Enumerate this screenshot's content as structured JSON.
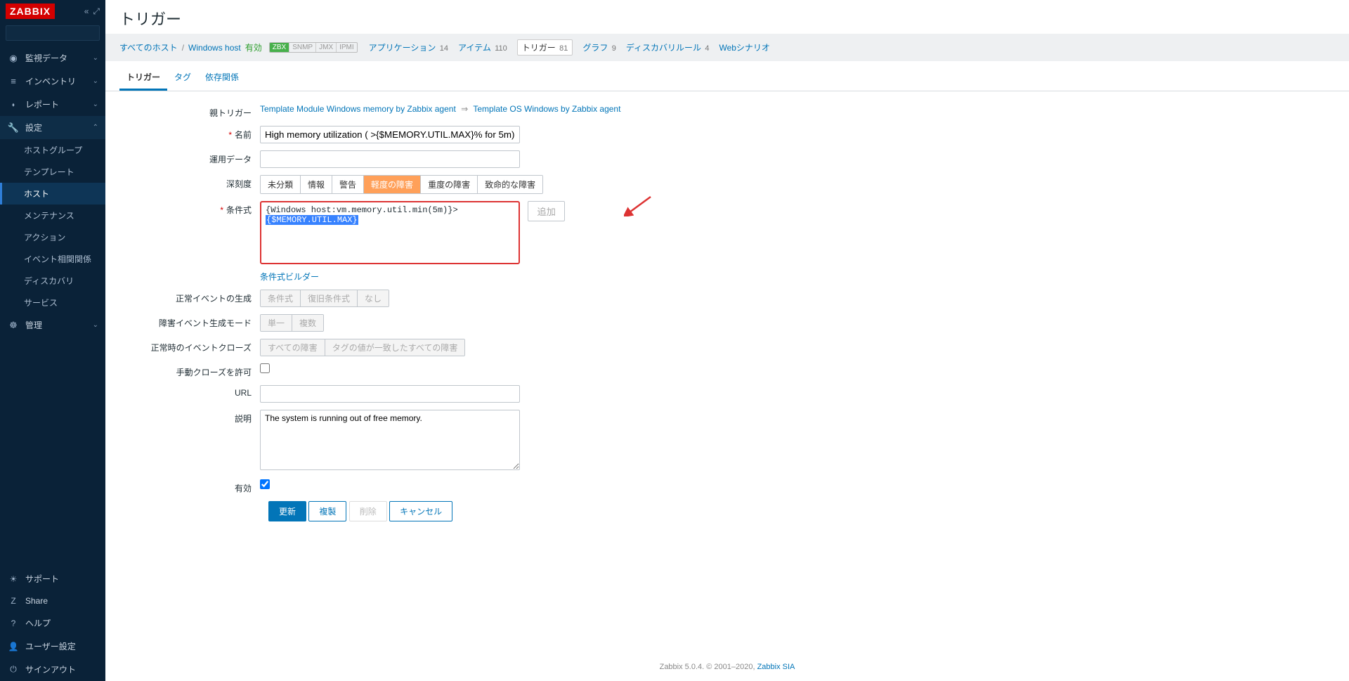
{
  "brand": "ZABBIX",
  "sidebar": {
    "search_placeholder": "",
    "items": [
      {
        "icon": "◉",
        "label": "監視データ"
      },
      {
        "icon": "≡",
        "label": "インベントリ"
      },
      {
        "icon": "⬪",
        "label": "レポート"
      },
      {
        "icon": "🔧",
        "label": "設定",
        "open": true
      },
      {
        "icon": "☸",
        "label": "管理"
      }
    ],
    "subitems": [
      "ホストグループ",
      "テンプレート",
      "ホスト",
      "メンテナンス",
      "アクション",
      "イベント相関関係",
      "ディスカバリ",
      "サービス"
    ],
    "bottom": [
      {
        "icon": "☀",
        "label": "サポート"
      },
      {
        "icon": "Z",
        "label": "Share"
      },
      {
        "icon": "?",
        "label": "ヘルプ"
      },
      {
        "icon": "👤",
        "label": "ユーザー設定"
      },
      {
        "icon": "⏻",
        "label": "サインアウト"
      }
    ]
  },
  "page": {
    "title": "トリガー",
    "bc_all_hosts": "すべてのホスト",
    "bc_host": "Windows host",
    "status": "有効",
    "badges": [
      "ZBX",
      "SNMP",
      "JMX",
      "IPMI"
    ],
    "hostnav": [
      {
        "label": "アプリケーション",
        "count": "14"
      },
      {
        "label": "アイテム",
        "count": "110"
      },
      {
        "label": "トリガー",
        "count": "81",
        "current": true
      },
      {
        "label": "グラフ",
        "count": "9"
      },
      {
        "label": "ディスカバリルール",
        "count": "4"
      },
      {
        "label": "Webシナリオ",
        "count": ""
      }
    ],
    "tabs": [
      "トリガー",
      "タグ",
      "依存関係"
    ]
  },
  "form": {
    "parent_label": "親トリガー",
    "parent_link1": "Template Module Windows memory by Zabbix agent",
    "parent_link2": "Template OS Windows by Zabbix agent",
    "name_label": "名前",
    "name_value": "High memory utilization ( >{$MEMORY.UTIL.MAX}% for 5m)",
    "opdata_label": "運用データ",
    "opdata_value": "",
    "sev_label": "深刻度",
    "sev_opts": [
      "未分類",
      "情報",
      "警告",
      "軽度の障害",
      "重度の障害",
      "致命的な障害"
    ],
    "expr_label": "条件式",
    "expr_prefix": "{Windows host:vm.memory.util.min(5m)}>",
    "expr_selected": "{$MEMORY.UTIL.MAX}",
    "add_btn": "追加",
    "builder_link": "条件式ビルダー",
    "okevent_label": "正常イベントの生成",
    "okevent_opts": [
      "条件式",
      "復旧条件式",
      "なし"
    ],
    "pbmode_label": "障害イベント生成モード",
    "pbmode_opts": [
      "単一",
      "複数"
    ],
    "okclose_label": "正常時のイベントクローズ",
    "okclose_opts": [
      "すべての障害",
      "タグの値が一致したすべての障害"
    ],
    "manual_label": "手動クローズを許可",
    "url_label": "URL",
    "url_value": "",
    "desc_label": "説明",
    "desc_value": "The system is running out of free memory.",
    "enabled_label": "有効",
    "buttons": {
      "update": "更新",
      "clone": "複製",
      "delete": "削除",
      "cancel": "キャンセル"
    }
  },
  "footer": {
    "text": "Zabbix 5.0.4. © 2001–2020, ",
    "link": "Zabbix SIA"
  }
}
